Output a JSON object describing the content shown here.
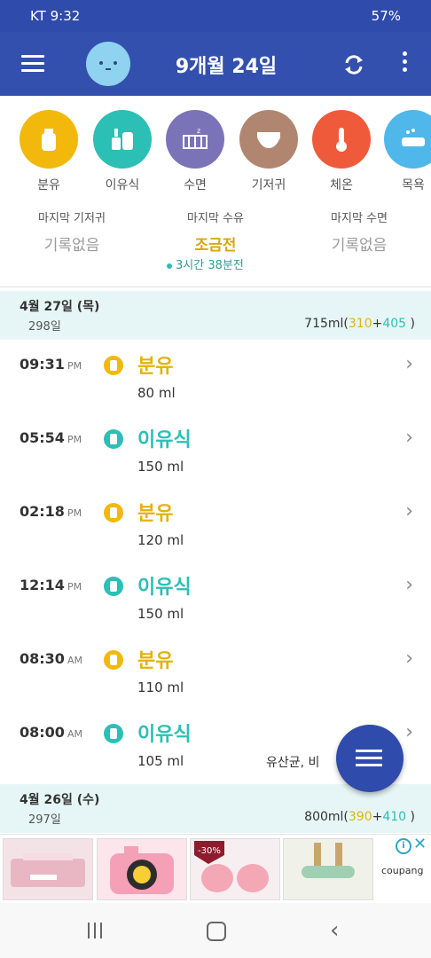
{
  "status_bar": {
    "carrier_time": "KT  9:32",
    "battery": "57%"
  },
  "app_bar": {
    "title": "9개월 24일"
  },
  "categories": [
    {
      "label": "분유",
      "color": "#f2b90c"
    },
    {
      "label": "이유식",
      "color": "#2bbfb5"
    },
    {
      "label": "수면",
      "color": "#7b73b8"
    },
    {
      "label": "기저귀",
      "color": "#b18670"
    },
    {
      "label": "체온",
      "color": "#ef5a3a"
    },
    {
      "label": "목욕",
      "color": "#4fb7ea"
    }
  ],
  "last_records": [
    {
      "title": "마지막 기저귀",
      "value": "기록없음"
    },
    {
      "title": "마지막 수유",
      "value": "조금전"
    },
    {
      "title": "마지막 수면",
      "value": "기록없음"
    }
  ],
  "last_feed_ago": "3시간 38분전",
  "days": [
    {
      "date": "4월 27일 (목)",
      "age": "298일",
      "total": "715ml",
      "formula": "310",
      "food": "405"
    },
    {
      "date": "4월 26일 (수)",
      "age": "297일",
      "total": "800ml",
      "formula": "390",
      "food": "410"
    }
  ],
  "entries": [
    {
      "time": "09:31",
      "ampm": "PM",
      "name": "분유",
      "amount": "80 ml",
      "kind": "formula"
    },
    {
      "time": "05:54",
      "ampm": "PM",
      "name": "이유식",
      "amount": "150 ml",
      "kind": "food"
    },
    {
      "time": "02:18",
      "ampm": "PM",
      "name": "분유",
      "amount": "120 ml",
      "kind": "formula"
    },
    {
      "time": "12:14",
      "ampm": "PM",
      "name": "이유식",
      "amount": "150 ml",
      "kind": "food"
    },
    {
      "time": "08:30",
      "ampm": "AM",
      "name": "분유",
      "amount": "110 ml",
      "kind": "formula"
    },
    {
      "time": "08:00",
      "ampm": "AM",
      "name": "이유식",
      "amount": "105 ml",
      "kind": "food",
      "note": "유산균, 비"
    }
  ],
  "ad": {
    "brand": "coupang",
    "discount": "-30%"
  },
  "colors": {
    "primary": "#3350ae",
    "formula": "#f2b90c",
    "food": "#2bbfb5"
  }
}
